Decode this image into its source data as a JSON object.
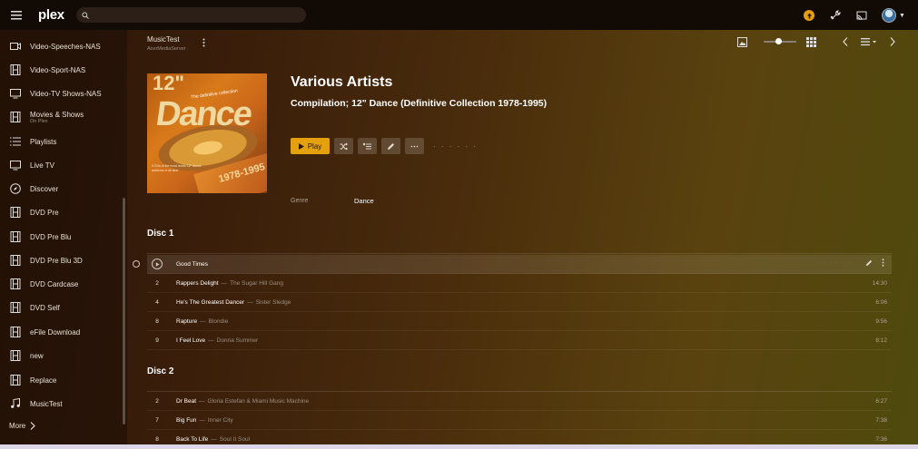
{
  "app": {
    "logo": "plex"
  },
  "search": {
    "placeholder": "",
    "value": ""
  },
  "sidebar": {
    "items": [
      {
        "label": "Video-Speeches-NAS",
        "icon": "video-camera-icon"
      },
      {
        "label": "Video-Sport-NAS",
        "icon": "film-icon"
      },
      {
        "label": "Video-TV Shows-NAS",
        "icon": "tv-icon"
      },
      {
        "label": "Movies & Shows",
        "sub": "On Plex",
        "icon": "film-icon"
      },
      {
        "label": "Playlists",
        "icon": "list-icon"
      },
      {
        "label": "Live TV",
        "icon": "tv-icon"
      },
      {
        "label": "Discover",
        "icon": "compass-icon"
      },
      {
        "label": "DVD Pre",
        "icon": "film-icon"
      },
      {
        "label": "DVD Pre Blu",
        "icon": "film-icon"
      },
      {
        "label": "DVD Pre Blu 3D",
        "icon": "film-icon"
      },
      {
        "label": "DVD Cardcase",
        "icon": "film-icon"
      },
      {
        "label": "DVD Self",
        "icon": "film-icon"
      },
      {
        "label": "eFile Download",
        "icon": "film-icon"
      },
      {
        "label": "new",
        "icon": "film-icon"
      },
      {
        "label": "Replace",
        "icon": "film-icon"
      },
      {
        "label": "MusicTest",
        "icon": "music-icon"
      }
    ],
    "more_label": "More"
  },
  "header": {
    "library": "MusicTest",
    "server": "AcerMediaServer",
    "slider_level": 0.45
  },
  "album": {
    "artist": "Various Artists",
    "title": "Compilation; 12\" Dance (Definitive Collection 1978-1995)",
    "play_label": "Play",
    "genre_label": "Genre",
    "genre_value": "Dance",
    "cover": {
      "big_text": "Dance",
      "num_text": "12\"",
      "tag_text": "The definitive collection",
      "years": "1978-1995",
      "desc": "3 CDs of the most iconic 12\" dance anthems of all time"
    }
  },
  "discs": [
    {
      "label": "Disc 1",
      "tracks": [
        {
          "num": "",
          "title": "Good Times",
          "artist": "",
          "duration": ""
        },
        {
          "num": "2",
          "title": "Rappers Delight",
          "artist": "The Sugar Hill Gang",
          "duration": "14:30"
        },
        {
          "num": "4",
          "title": "He's The Greatest Dancer",
          "artist": "Sister Sledge",
          "duration": "6:06"
        },
        {
          "num": "8",
          "title": "Rapture",
          "artist": "Blondie",
          "duration": "9:56"
        },
        {
          "num": "9",
          "title": "I Feel Love",
          "artist": "Donna Summer",
          "duration": "8:12"
        }
      ]
    },
    {
      "label": "Disc 2",
      "tracks": [
        {
          "num": "2",
          "title": "Dr Beat",
          "artist": "Gloria Estefan & Miami Music Machine",
          "duration": "6:27"
        },
        {
          "num": "7",
          "title": "Big Fun",
          "artist": "Inner City",
          "duration": "7:38"
        },
        {
          "num": "8",
          "title": "Back To Life",
          "artist": "Soul II Soul",
          "duration": "7:36"
        }
      ]
    }
  ],
  "separator": "—"
}
